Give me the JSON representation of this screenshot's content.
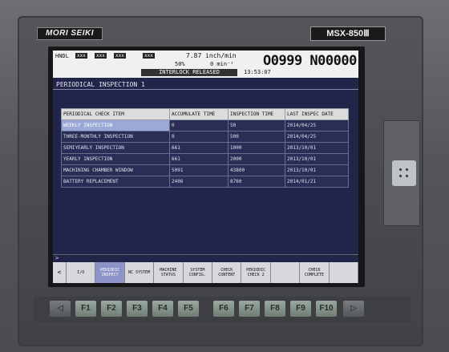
{
  "bezel": {
    "brand": "MORI SEIKI",
    "model": "MSX-850Ⅲ"
  },
  "status": {
    "hndl": "HNDL",
    "axes": [
      "xxx",
      "xxx",
      "xxx",
      "xxx"
    ],
    "feed": "7.87 inch/min",
    "override": "50%",
    "spindle": "0 min⁻¹",
    "program": "O0999 N00000",
    "interlock": "INTERLOCK RELEASED",
    "time": "13:53:07"
  },
  "page_title": "PERIODICAL INSPECTION 1",
  "table": {
    "headers": [
      "PERIODICAL CHECK ITEM",
      "ACCUMULATE TIME",
      "INSPECTION TIME",
      "LAST INSPEC DATE"
    ],
    "rows": [
      [
        "WEEKLY INSPECTION",
        "0",
        "50",
        "2014/04/25"
      ],
      [
        "THREE-MONTHLY INSPECTION",
        "0",
        "500",
        "2014/04/25"
      ],
      [
        "SEMIYEARLY INSPECTION",
        "661",
        "1000",
        "2013/10/01"
      ],
      [
        "YEARLY INSPECTION",
        "661",
        "2000",
        "2013/10/01"
      ],
      [
        "MACHINING CHAMBER WINDOW",
        "5091",
        "43800",
        "2013/10/01"
      ],
      [
        "BATTERY REPLACEMENT",
        "2406",
        "8760",
        "2014/01/21"
      ]
    ]
  },
  "cmd_prompt": ">",
  "softkeys": [
    "<",
    "I/O",
    "PERIODIC INSPECT",
    "NC SYSTEM",
    "MACHINE STATUS",
    "SYSTEM CONFIG.",
    "CHECK CONTENT",
    "PERIODIC CHECK 2",
    "",
    "CHECK COMPLETE",
    ""
  ],
  "fkeys": [
    "◁",
    "F1",
    "F2",
    "F3",
    "F4",
    "F5",
    "F6",
    "F7",
    "F8",
    "F9",
    "F10",
    "▷"
  ]
}
